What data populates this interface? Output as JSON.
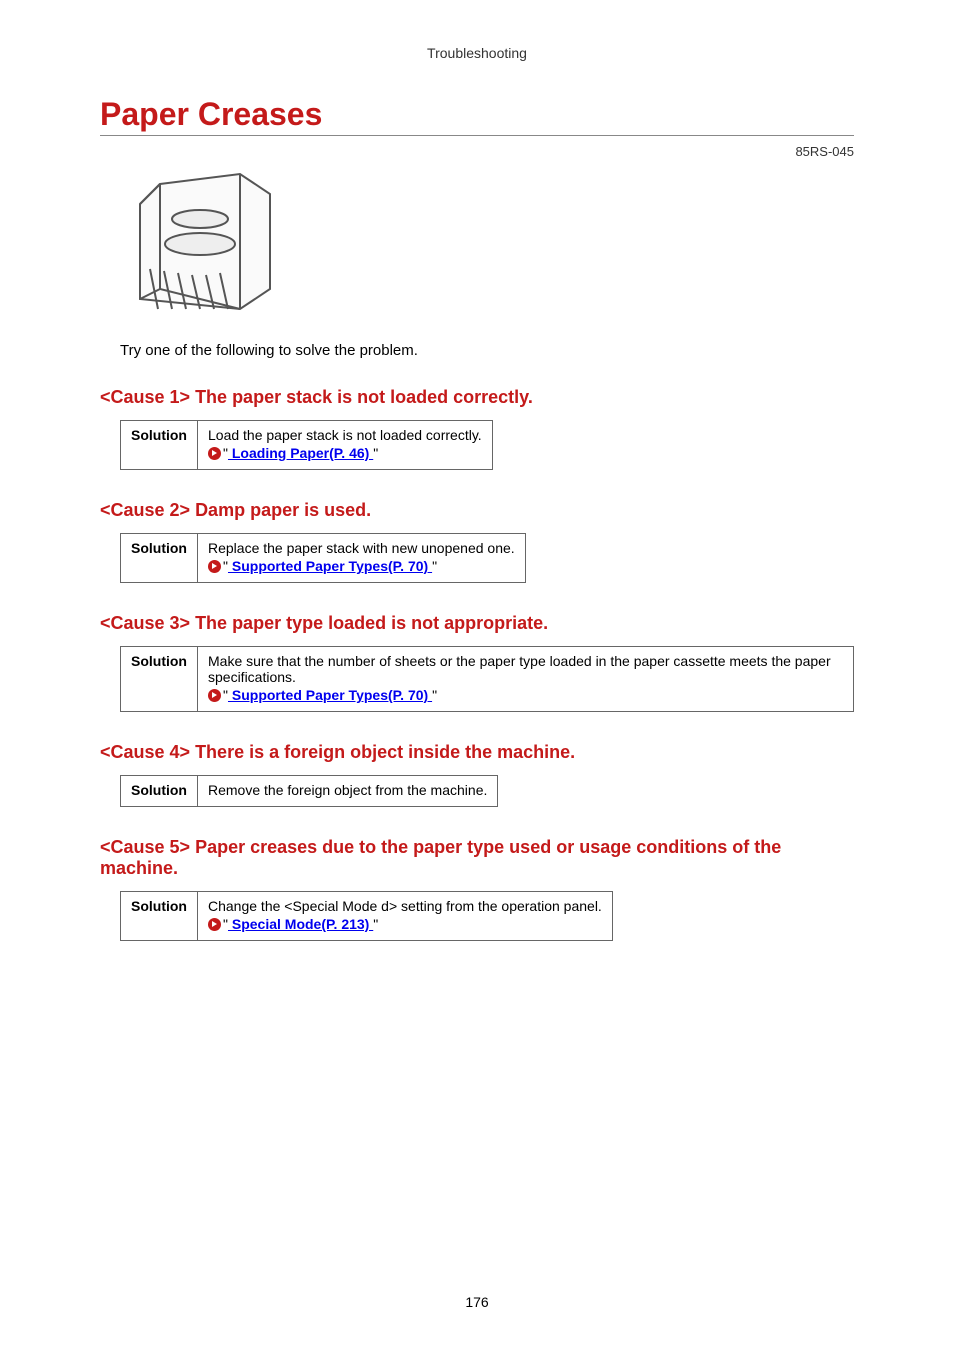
{
  "breadcrumb": "Troubleshooting",
  "title": "Paper Creases",
  "docId": "85RS-045",
  "intro": "Try one of the following to solve the problem.",
  "solutionLabel": "Solution",
  "causes": [
    {
      "heading": "<Cause 1> The paper stack is not loaded correctly.",
      "body": "Load the paper stack is not loaded correctly.",
      "linkPrefix": "\"",
      "linkText": " Loading Paper(P. 46) ",
      "linkSuffix": "\""
    },
    {
      "heading": "<Cause 2> Damp paper is used.",
      "body": "Replace the paper stack with new unopened one.",
      "linkPrefix": "\"",
      "linkText": " Supported Paper Types(P. 70) ",
      "linkSuffix": "\""
    },
    {
      "heading": "<Cause 3> The paper type loaded is not appropriate.",
      "body": "Make sure that the number of sheets or the paper type loaded in the paper cassette meets the paper specifications.",
      "linkPrefix": "\"",
      "linkText": " Supported Paper Types(P. 70) ",
      "linkSuffix": "\""
    },
    {
      "heading": "<Cause 4> There is a foreign object inside the machine.",
      "body": "Remove the foreign object from the machine.",
      "linkPrefix": "",
      "linkText": "",
      "linkSuffix": ""
    },
    {
      "heading": "<Cause 5> Paper creases due to the paper type used or usage conditions of the machine.",
      "body": "Change the <Special Mode d> setting from the operation panel.",
      "linkPrefix": "\"",
      "linkText": " Special Mode(P. 213) ",
      "linkSuffix": "\""
    }
  ],
  "pageNumber": "176"
}
